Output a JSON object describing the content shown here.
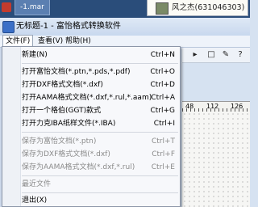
{
  "taskbar": {
    "tab_label": "-1.mar",
    "chat": {
      "text": "风之杰(631046303)"
    }
  },
  "window": {
    "title": "无标题-1 - 富怡格式转换软件"
  },
  "menubar": {
    "items": [
      "文件(F)",
      "查看(V)",
      "帮助(H)"
    ]
  },
  "toolbar": {
    "help_glyph": "?"
  },
  "ruler": {
    "labels": [
      "48",
      "112",
      "126"
    ]
  },
  "file_menu": {
    "items": [
      {
        "label": "新建(N)",
        "shortcut": "Ctrl+N",
        "enabled": true
      },
      {
        "label": "打开富怡文档(*.ptn,*.pds,*.pdf)",
        "shortcut": "Ctrl+O",
        "enabled": true
      },
      {
        "label": "打开DXF格式文档(*.dxf)",
        "shortcut": "Ctrl+D",
        "enabled": true
      },
      {
        "label": "打开AAMA格式文档(*.dxf,*.rul,*.aam)",
        "shortcut": "Ctrl+A",
        "enabled": true
      },
      {
        "label": "打开一个格伯(GGT)款式",
        "shortcut": "Ctrl+G",
        "enabled": true
      },
      {
        "label": "打开力克IBA纸样文件(*.IBA)",
        "shortcut": "Ctrl+I",
        "enabled": true
      },
      {
        "label": "保存为富怡文档(*.ptn)",
        "shortcut": "Ctrl+T",
        "enabled": false
      },
      {
        "label": "保存为DXF格式文档(*.dxf)",
        "shortcut": "Ctrl+F",
        "enabled": false
      },
      {
        "label": "保存为AAMA格式文档(*.dxf,*.rul)",
        "shortcut": "Ctrl+E",
        "enabled": false
      },
      {
        "label": "最近文件",
        "shortcut": "",
        "enabled": false
      },
      {
        "label": "退出(X)",
        "shortcut": "",
        "enabled": true
      }
    ]
  }
}
